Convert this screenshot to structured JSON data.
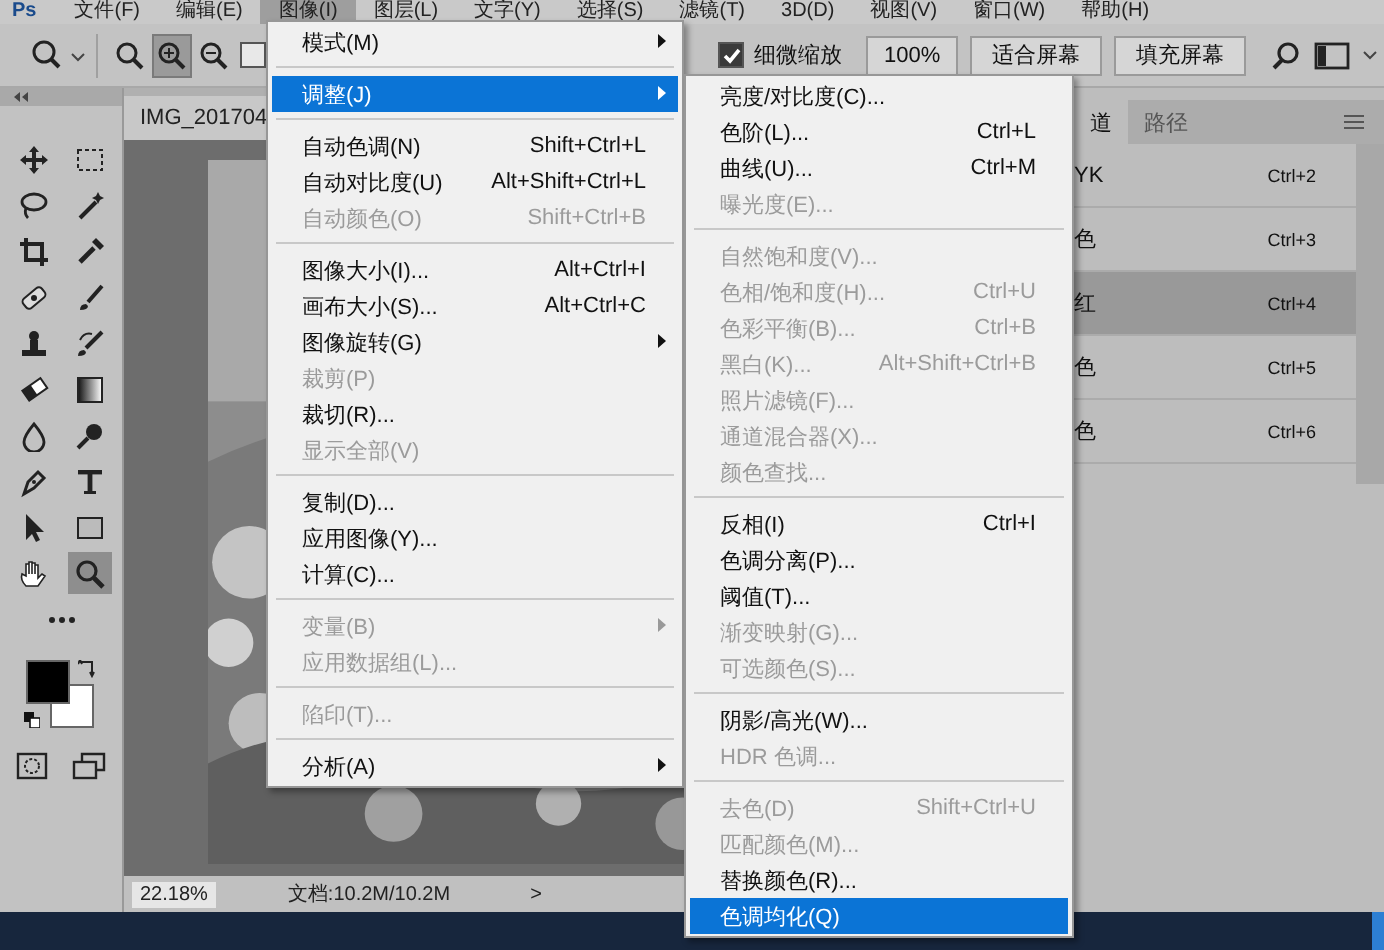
{
  "menubar": {
    "logo": "Ps",
    "items": [
      {
        "label": "文件(F)",
        "selected": false
      },
      {
        "label": "编辑(E)",
        "selected": false
      },
      {
        "label": "图像(I)",
        "selected": true
      },
      {
        "label": "图层(L)",
        "selected": false
      },
      {
        "label": "文字(Y)",
        "selected": false
      },
      {
        "label": "选择(S)",
        "selected": false
      },
      {
        "label": "滤镜(T)",
        "selected": false
      },
      {
        "label": "3D(D)",
        "selected": false
      },
      {
        "label": "视图(V)",
        "selected": false
      },
      {
        "label": "窗口(W)",
        "selected": false
      },
      {
        "label": "帮助(H)",
        "selected": false
      }
    ]
  },
  "options_bar": {
    "zoom_buttons": [
      {
        "selected": false
      },
      {
        "selected": true
      },
      {
        "selected": false
      }
    ],
    "resize_checkbox": {
      "checked": false
    },
    "scrubby_zoom": {
      "label": "细微缩放",
      "checked": true
    },
    "buttons": [
      "100%",
      "适合屏幕",
      "填充屏幕"
    ]
  },
  "toolbox": {
    "tools": [
      {
        "selected": false
      },
      {
        "selected": false
      },
      {
        "selected": false
      },
      {
        "selected": false
      },
      {
        "selected": false
      },
      {
        "selected": false
      },
      {
        "selected": false
      },
      {
        "selected": false
      },
      {
        "selected": false
      },
      {
        "selected": false
      },
      {
        "selected": false
      },
      {
        "selected": false
      },
      {
        "selected": false
      },
      {
        "selected": false
      },
      {
        "selected": false
      },
      {
        "selected": false
      },
      {
        "selected": false
      },
      {
        "selected": false
      },
      {
        "selected": false
      },
      {
        "selected": true
      },
      {
        "selected": false
      }
    ]
  },
  "document": {
    "tab": "IMG_201704",
    "zoom": "22.18%",
    "info": "文档:10.2M/10.2M",
    "more": ">"
  },
  "panel": {
    "tabs": [
      {
        "label": "道",
        "selected": true
      },
      {
        "label": "路径",
        "selected": false
      }
    ],
    "channels": [
      {
        "name": "YK",
        "shortcut": "Ctrl+2",
        "selected": false
      },
      {
        "name": "色",
        "shortcut": "Ctrl+3",
        "selected": false
      },
      {
        "name": "红",
        "shortcut": "Ctrl+4",
        "selected": true
      },
      {
        "name": "色",
        "shortcut": "Ctrl+5",
        "selected": false
      },
      {
        "name": "色",
        "shortcut": "Ctrl+6",
        "selected": false
      }
    ]
  },
  "image_menu": {
    "sections": [
      [
        {
          "label": "模式(M)",
          "disabled": false,
          "submenu": true,
          "selected": false
        }
      ],
      [
        {
          "label": "调整(J)",
          "disabled": false,
          "submenu": true,
          "selected": true
        }
      ],
      [
        {
          "label": "自动色调(N)",
          "shortcut": "Shift+Ctrl+L",
          "disabled": false,
          "submenu": false,
          "selected": false
        },
        {
          "label": "自动对比度(U)",
          "shortcut": "Alt+Shift+Ctrl+L",
          "disabled": false,
          "submenu": false,
          "selected": false
        },
        {
          "label": "自动颜色(O)",
          "shortcut": "Shift+Ctrl+B",
          "disabled": true,
          "submenu": false,
          "selected": false
        }
      ],
      [
        {
          "label": "图像大小(I)...",
          "shortcut": "Alt+Ctrl+I",
          "disabled": false,
          "submenu": false,
          "selected": false
        },
        {
          "label": "画布大小(S)...",
          "shortcut": "Alt+Ctrl+C",
          "disabled": false,
          "submenu": false,
          "selected": false
        },
        {
          "label": "图像旋转(G)",
          "disabled": false,
          "submenu": true,
          "selected": false
        },
        {
          "label": "裁剪(P)",
          "disabled": true,
          "submenu": false,
          "selected": false
        },
        {
          "label": "裁切(R)...",
          "disabled": false,
          "submenu": false,
          "selected": false
        },
        {
          "label": "显示全部(V)",
          "disabled": true,
          "submenu": false,
          "selected": false
        }
      ],
      [
        {
          "label": "复制(D)...",
          "disabled": false,
          "submenu": false,
          "selected": false
        },
        {
          "label": "应用图像(Y)...",
          "disabled": false,
          "submenu": false,
          "selected": false
        },
        {
          "label": "计算(C)...",
          "disabled": false,
          "submenu": false,
          "selected": false
        }
      ],
      [
        {
          "label": "变量(B)",
          "disabled": true,
          "submenu": true,
          "selected": false
        },
        {
          "label": "应用数据组(L)...",
          "disabled": true,
          "submenu": false,
          "selected": false
        }
      ],
      [
        {
          "label": "陷印(T)...",
          "disabled": true,
          "submenu": false,
          "selected": false
        }
      ],
      [
        {
          "label": "分析(A)",
          "disabled": false,
          "submenu": true,
          "selected": false
        }
      ]
    ]
  },
  "adjustments_menu": {
    "sections": [
      [
        {
          "label": "亮度/对比度(C)...",
          "disabled": false,
          "submenu": false,
          "selected": false
        },
        {
          "label": "色阶(L)...",
          "shortcut": "Ctrl+L",
          "disabled": false,
          "submenu": false,
          "selected": false
        },
        {
          "label": "曲线(U)...",
          "shortcut": "Ctrl+M",
          "disabled": false,
          "submenu": false,
          "selected": false
        },
        {
          "label": "曝光度(E)...",
          "disabled": true,
          "submenu": false,
          "selected": false
        }
      ],
      [
        {
          "label": "自然饱和度(V)...",
          "disabled": true,
          "submenu": false,
          "selected": false
        },
        {
          "label": "色相/饱和度(H)...",
          "shortcut": "Ctrl+U",
          "disabled": true,
          "submenu": false,
          "selected": false
        },
        {
          "label": "色彩平衡(B)...",
          "shortcut": "Ctrl+B",
          "disabled": true,
          "submenu": false,
          "selected": false
        },
        {
          "label": "黑白(K)...",
          "shortcut": "Alt+Shift+Ctrl+B",
          "disabled": true,
          "submenu": false,
          "selected": false
        },
        {
          "label": "照片滤镜(F)...",
          "disabled": true,
          "submenu": false,
          "selected": false
        },
        {
          "label": "通道混合器(X)...",
          "disabled": true,
          "submenu": false,
          "selected": false
        },
        {
          "label": "颜色查找...",
          "disabled": true,
          "submenu": false,
          "selected": false
        }
      ],
      [
        {
          "label": "反相(I)",
          "shortcut": "Ctrl+I",
          "disabled": false,
          "submenu": false,
          "selected": false
        },
        {
          "label": "色调分离(P)...",
          "disabled": false,
          "submenu": false,
          "selected": false
        },
        {
          "label": "阈值(T)...",
          "disabled": false,
          "submenu": false,
          "selected": false
        },
        {
          "label": "渐变映射(G)...",
          "disabled": true,
          "submenu": false,
          "selected": false
        },
        {
          "label": "可选颜色(S)...",
          "disabled": true,
          "submenu": false,
          "selected": false
        }
      ],
      [
        {
          "label": "阴影/高光(W)...",
          "disabled": false,
          "submenu": false,
          "selected": false
        },
        {
          "label": "HDR 色调...",
          "disabled": true,
          "submenu": false,
          "selected": false
        }
      ],
      [
        {
          "label": "去色(D)",
          "shortcut": "Shift+Ctrl+U",
          "disabled": true,
          "submenu": false,
          "selected": false
        },
        {
          "label": "匹配颜色(M)...",
          "disabled": true,
          "submenu": false,
          "selected": false
        },
        {
          "label": "替换颜色(R)...",
          "disabled": false,
          "submenu": false,
          "selected": false
        },
        {
          "label": "色调均化(Q)",
          "disabled": false,
          "submenu": false,
          "selected": true
        }
      ]
    ]
  }
}
